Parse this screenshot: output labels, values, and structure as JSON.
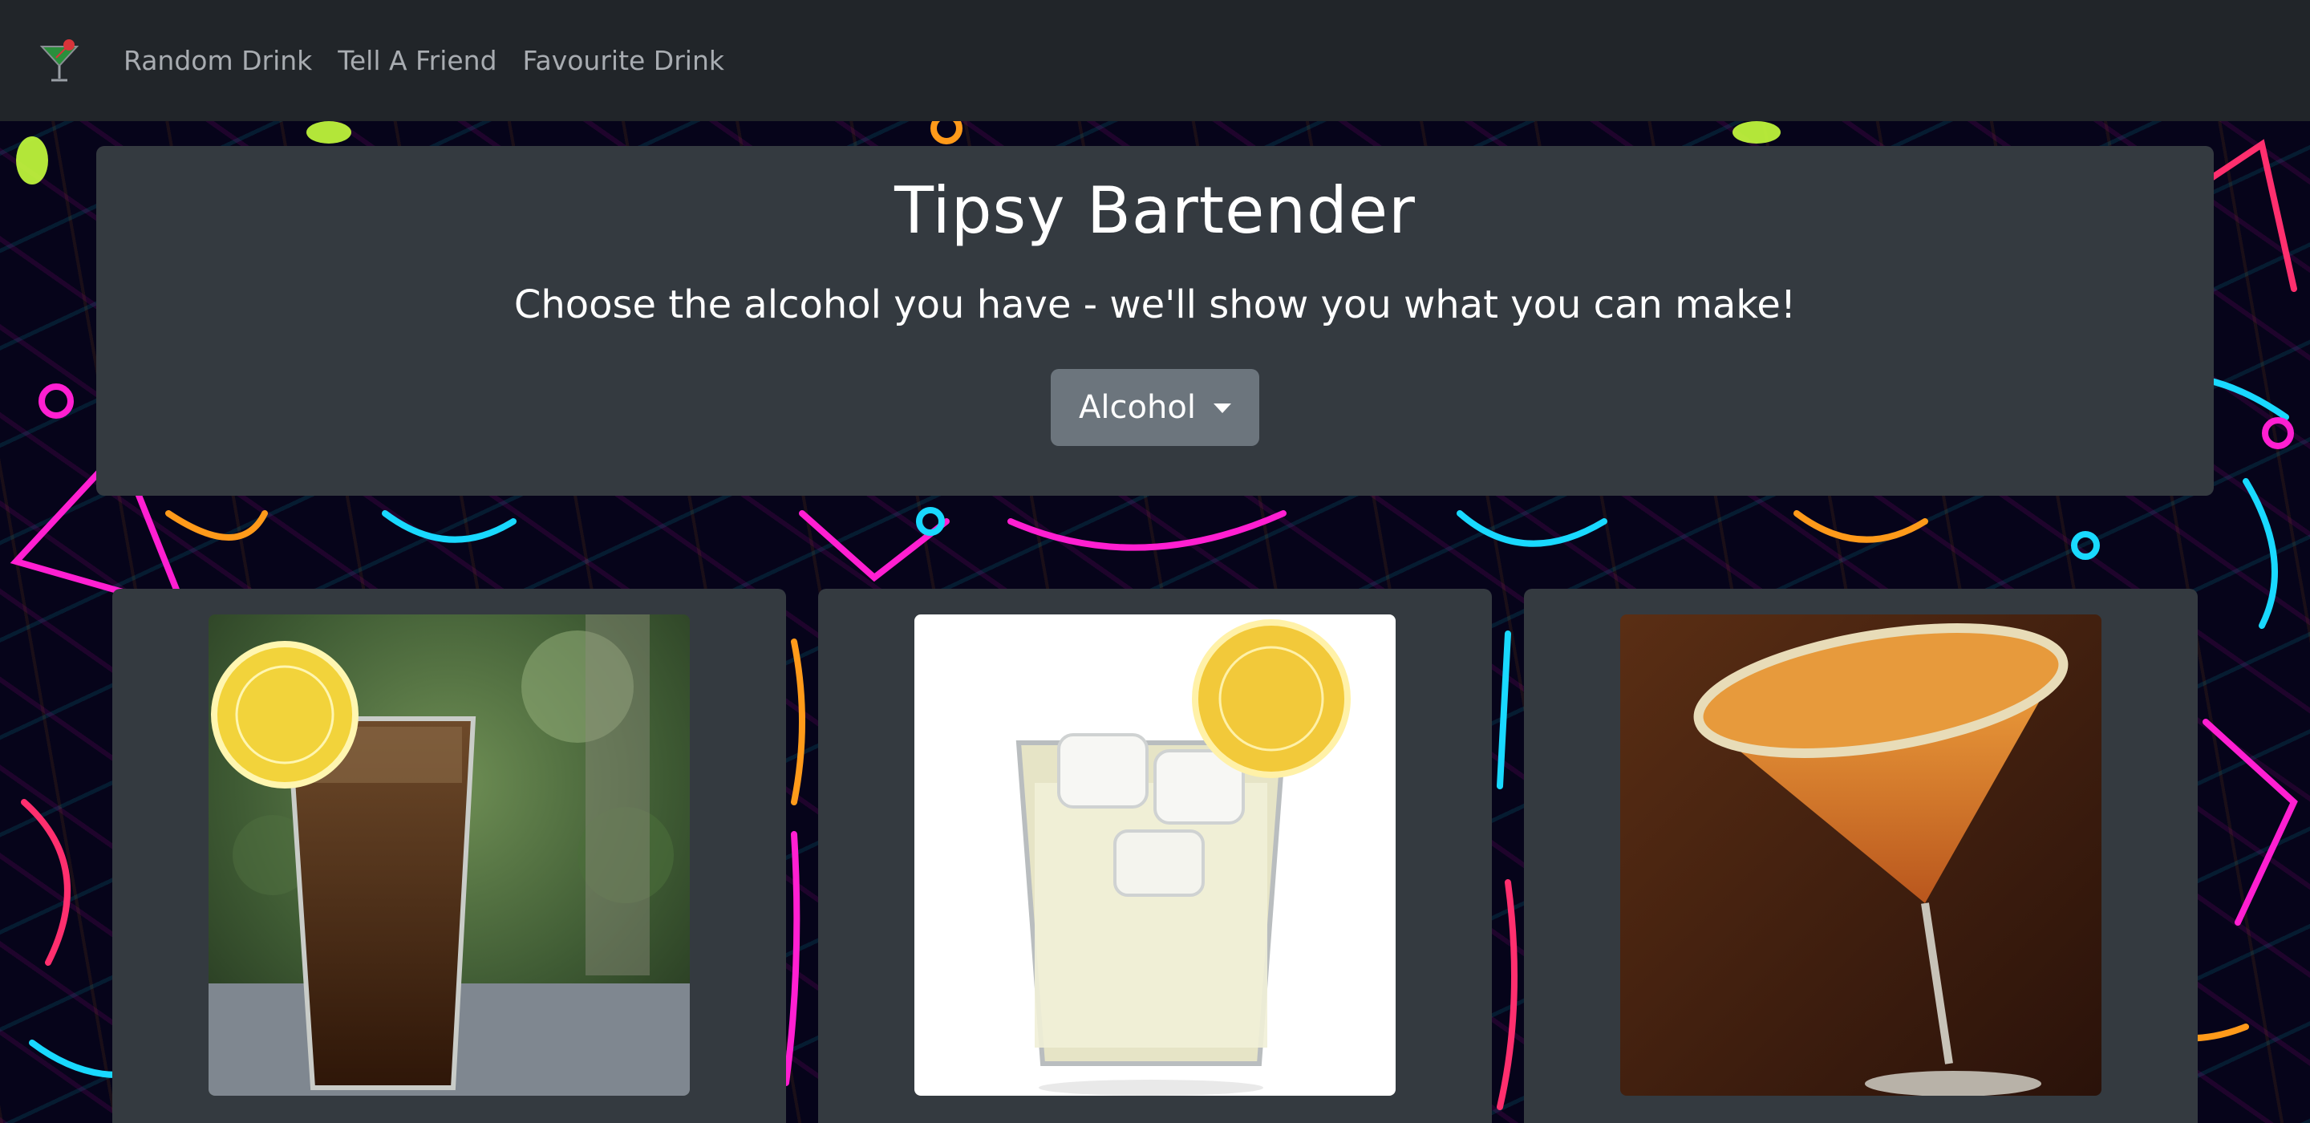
{
  "nav": {
    "brand_icon": "cocktail-icon",
    "links": [
      "Random Drink",
      "Tell A Friend",
      "Favourite Drink"
    ]
  },
  "hero": {
    "title": "Tipsy Bartender",
    "subtitle": "Choose the alcohol you have - we'll show you what you can make!",
    "dropdown_label": "Alcohol"
  },
  "drinks": [
    {
      "image": "cola-highball-lemon"
    },
    {
      "image": "lemonade-rocks-lemon"
    },
    {
      "image": "orange-martini-sugar-rim"
    }
  ],
  "colors": {
    "navbar": "#212529",
    "panel": "#343a40",
    "button": "#6c757d",
    "nav_link": "#a8acb1",
    "text": "#ffffff"
  }
}
